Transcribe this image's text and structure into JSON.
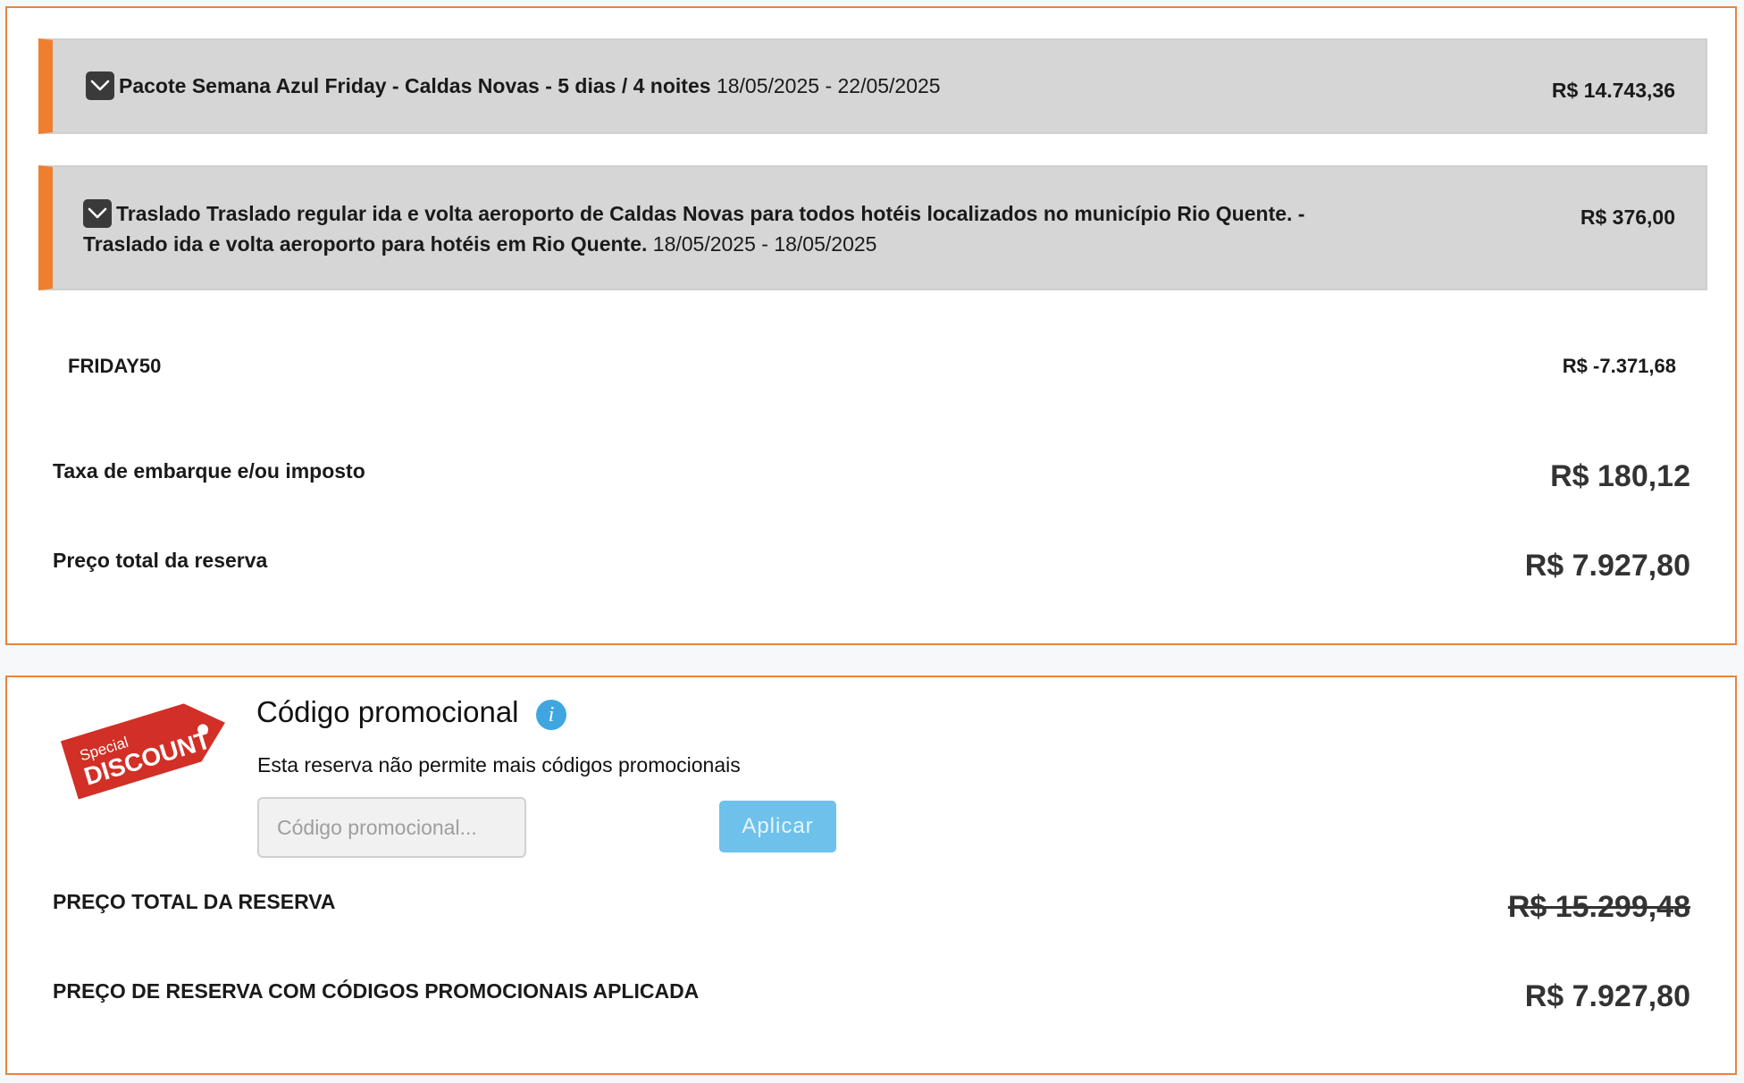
{
  "items": [
    {
      "title": "Pacote Semana Azul Friday - Caldas Novas - 5 dias / 4 noites",
      "dates": "18/05/2025 - 22/05/2025",
      "price": "R$ 14.743,36"
    },
    {
      "title": "Traslado Traslado regular ida e volta aeroporto de Caldas Novas para todos hotéis localizados no município Rio Quente. - Traslado ida e volta aeroporto para hotéis em Rio Quente.",
      "dates": "18/05/2025 - 18/05/2025",
      "price": "R$ 376,00"
    }
  ],
  "coupon": {
    "code": "FRIDAY50",
    "value": "R$ -7.371,68"
  },
  "tax": {
    "label": "Taxa de embarque e/ou imposto",
    "value": "R$ 180,12"
  },
  "total": {
    "label": "Preço total da reserva",
    "value": "R$ 7.927,80"
  },
  "promo": {
    "tag_line1": "Special",
    "tag_line2": "DISCOUNT",
    "title": "Código promocional",
    "info_glyph": "i",
    "note": "Esta reserva não permite mais códigos promocionais",
    "input_placeholder": "Código promocional...",
    "apply_label": "Aplicar",
    "total_label": "PREÇO TOTAL DA RESERVA",
    "total_original": "R$ 15.299,48",
    "total_with_codes_label": "PREÇO DE RESERVA COM CÓDIGOS PROMOCIONAIS APLICADA",
    "total_with_codes_value": "R$ 7.927,80"
  },
  "colors": {
    "accent": "#ef7f2f",
    "item_bg": "#d6d6d6",
    "button": "#6ec1eb",
    "tag": "#d22f26"
  }
}
